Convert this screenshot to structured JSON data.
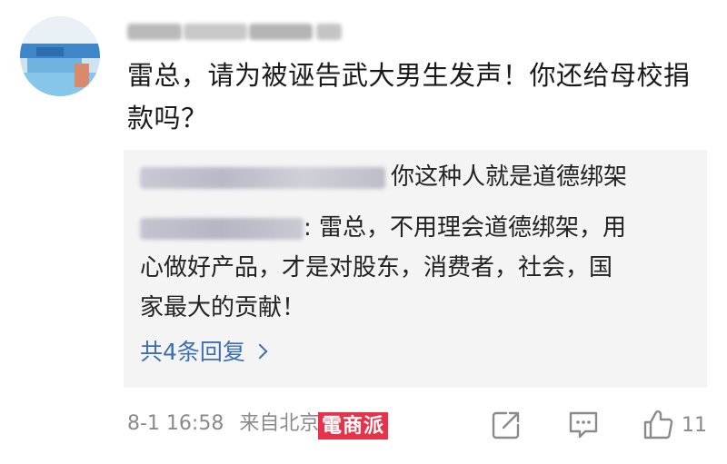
{
  "comment": {
    "text": "雷总，请为被诬告武大男生发声！你还给母校捐款吗？"
  },
  "replies": [
    {
      "text": "你这种人就是道德绑架"
    },
    {
      "text": ": 雷总，不用理会道德绑架，用"
    },
    {
      "text": "心做好产品，才是对股东，消费者，社会，国"
    },
    {
      "text": "家最大的贡献！"
    }
  ],
  "more_replies_label": "共4条回复",
  "meta": {
    "time": "8-1 16:58",
    "location": "来自北京"
  },
  "watermark": "電商派",
  "actions": {
    "like_count": "11",
    "icons": [
      "share-icon",
      "comment-icon",
      "like-icon"
    ]
  },
  "colors": {
    "link": "#3b6fb0",
    "watermark_bg": "#e8324a",
    "reply_bg": "#f4f4f4",
    "meta_text": "#8a8a8a"
  }
}
